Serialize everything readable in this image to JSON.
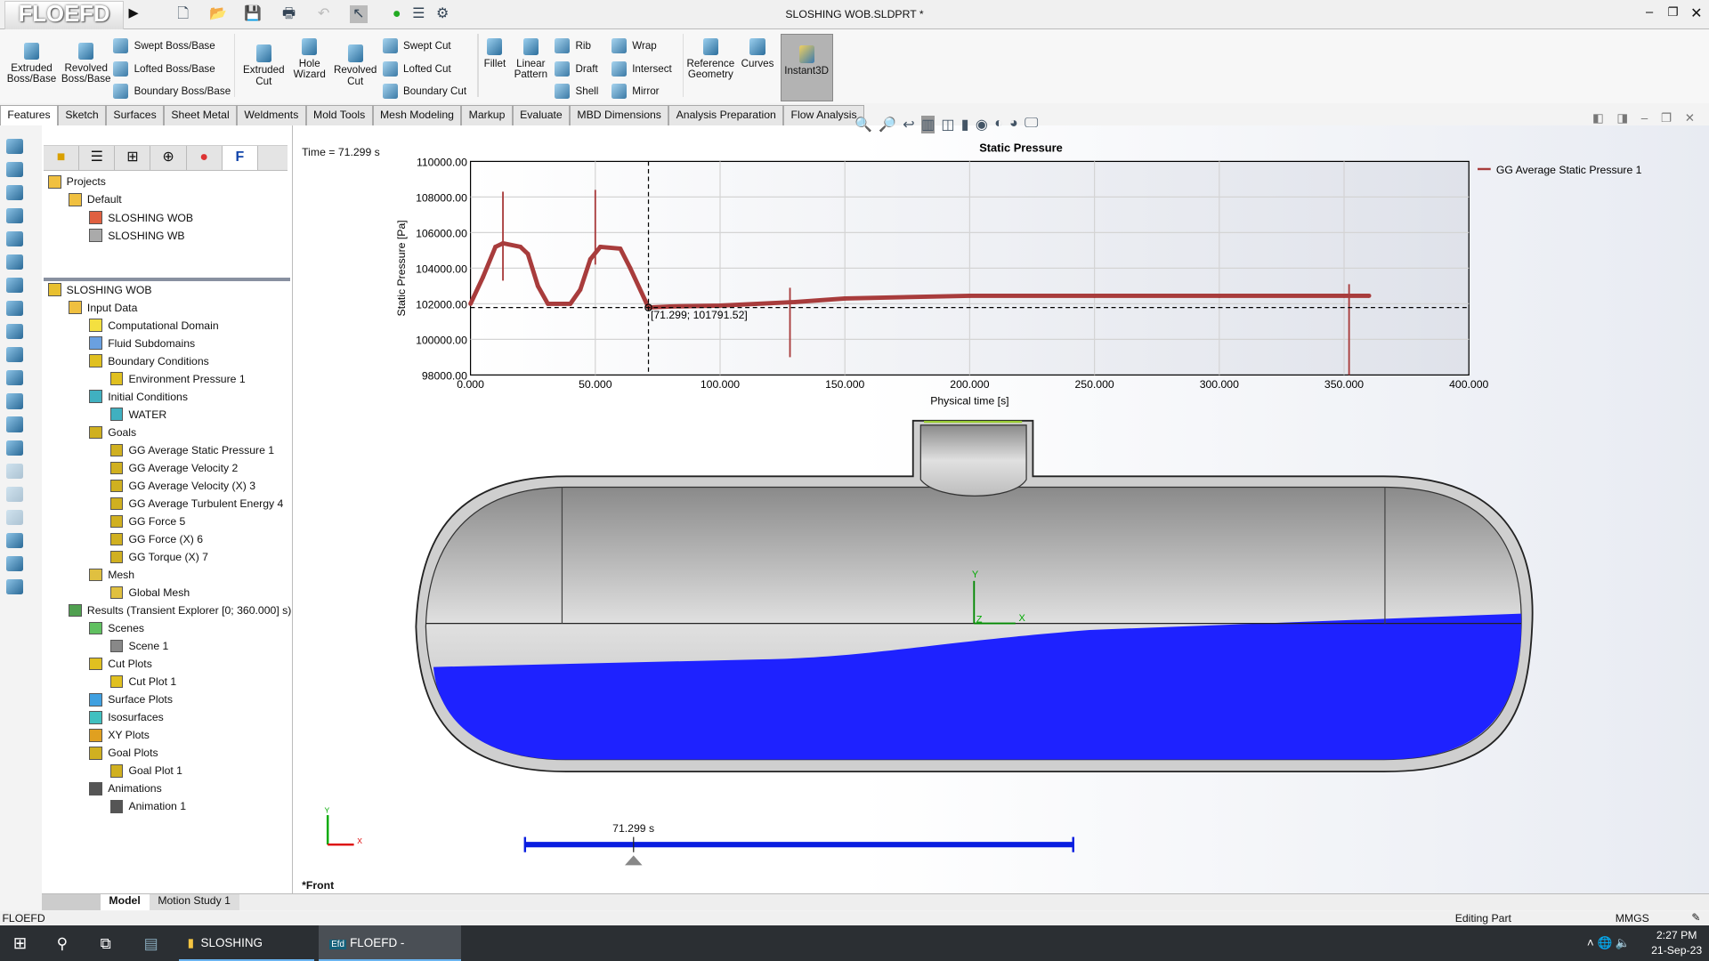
{
  "app": {
    "logo": "FLOEFD",
    "window_title": "SLOSHING WOB.SLDPRT *"
  },
  "quick_access": [
    "new-icon",
    "open-icon",
    "save-icon",
    "print-icon",
    "undo-icon",
    "select-icon",
    "rebuild-icon",
    "file-properties-icon",
    "options-icon"
  ],
  "ribbon": {
    "big": [
      {
        "label": "Extruded Boss/Base"
      },
      {
        "label": "Revolved Boss/Base"
      },
      {
        "label": "Extruded Cut"
      },
      {
        "label": "Hole Wizard"
      },
      {
        "label": "Revolved Cut"
      },
      {
        "label": "Fillet"
      },
      {
        "label": "Linear Pattern"
      },
      {
        "label": "Reference Geometry"
      },
      {
        "label": "Curves"
      },
      {
        "label": "Instant3D"
      }
    ],
    "small": [
      "Swept Boss/Base",
      "Lofted Boss/Base",
      "Boundary Boss/Base",
      "Swept Cut",
      "Lofted Cut",
      "Boundary Cut",
      "Rib",
      "Draft",
      "Shell",
      "Wrap",
      "Intersect",
      "Mirror"
    ]
  },
  "tabs": [
    "Features",
    "Sketch",
    "Surfaces",
    "Sheet Metal",
    "Weldments",
    "Mold Tools",
    "Mesh Modeling",
    "Markup",
    "Evaluate",
    "MBD Dimensions",
    "Analysis Preparation",
    "Flow Analysis"
  ],
  "active_tab": "Features",
  "projects_tree": [
    {
      "label": "Projects",
      "level": 0
    },
    {
      "label": "Default",
      "level": 1
    },
    {
      "label": "SLOSHING WOB",
      "level": 2
    },
    {
      "label": "SLOSHING WB",
      "level": 2
    }
  ],
  "analysis_tree": [
    {
      "label": "SLOSHING WOB",
      "level": 0,
      "color": "#e8c030"
    },
    {
      "label": "Input Data",
      "level": 1,
      "color": "#f0c040"
    },
    {
      "label": "Computational Domain",
      "level": 2,
      "color": "#f4e040"
    },
    {
      "label": "Fluid Subdomains",
      "level": 2,
      "color": "#6aa0e0"
    },
    {
      "label": "Boundary Conditions",
      "level": 2,
      "color": "#e0c020"
    },
    {
      "label": "Environment Pressure 1",
      "level": 3,
      "color": "#e0c020"
    },
    {
      "label": "Initial Conditions",
      "level": 2,
      "color": "#40b0c0"
    },
    {
      "label": "WATER",
      "level": 3,
      "color": "#40b0c0"
    },
    {
      "label": "Goals",
      "level": 2,
      "color": "#d0b020"
    },
    {
      "label": "GG Average Static Pressure 1",
      "level": 3,
      "color": "#d0b020"
    },
    {
      "label": "GG Average Velocity 2",
      "level": 3,
      "color": "#d0b020"
    },
    {
      "label": "GG Average Velocity (X) 3",
      "level": 3,
      "color": "#d0b020"
    },
    {
      "label": "GG Average Turbulent Energy 4",
      "level": 3,
      "color": "#d0b020"
    },
    {
      "label": "GG Force 5",
      "level": 3,
      "color": "#d0b020"
    },
    {
      "label": "GG Force (X) 6",
      "level": 3,
      "color": "#d0b020"
    },
    {
      "label": "GG Torque (X) 7",
      "level": 3,
      "color": "#d0b020"
    },
    {
      "label": "Mesh",
      "level": 2,
      "color": "#e0c040"
    },
    {
      "label": "Global Mesh",
      "level": 3,
      "color": "#e0c040"
    },
    {
      "label": "Results (Transient Explorer [0; 360.000] s)",
      "level": 1,
      "color": "#50a050"
    },
    {
      "label": "Scenes",
      "level": 2,
      "color": "#60c060"
    },
    {
      "label": "Scene 1",
      "level": 3,
      "color": "#888888"
    },
    {
      "label": "Cut Plots",
      "level": 2,
      "color": "#e0c020"
    },
    {
      "label": "Cut Plot 1",
      "level": 3,
      "color": "#e0c020"
    },
    {
      "label": "Surface Plots",
      "level": 2,
      "color": "#40a0e0"
    },
    {
      "label": "Isosurfaces",
      "level": 2,
      "color": "#40c0c0"
    },
    {
      "label": "XY Plots",
      "level": 2,
      "color": "#e0a020"
    },
    {
      "label": "Goal Plots",
      "level": 2,
      "color": "#d0b020"
    },
    {
      "label": "Goal Plot 1",
      "level": 3,
      "color": "#d0b020"
    },
    {
      "label": "Animations",
      "level": 2,
      "color": "#555555"
    },
    {
      "label": "Animation 1",
      "level": 3,
      "color": "#555555"
    }
  ],
  "view": {
    "time_label": "Time = 71.299 s",
    "slider_label": "71.299 s",
    "slider_fraction": 0.198,
    "view_name": "*Front",
    "axis_x": "X",
    "axis_y": "Y",
    "axis_z": "Z"
  },
  "chart_data": {
    "type": "line",
    "title": "Static Pressure",
    "xlabel": "Physical time [s]",
    "ylabel": "Static Pressure [Pa]",
    "xlim": [
      0,
      400
    ],
    "ylim": [
      98000,
      110000
    ],
    "xticks": [
      "0.000",
      "50.000",
      "100.000",
      "150.000",
      "200.000",
      "250.000",
      "300.000",
      "350.000",
      "400.000"
    ],
    "yticks": [
      "98000.00",
      "100000.00",
      "102000.00",
      "104000.00",
      "106000.00",
      "108000.00",
      "110000.00"
    ],
    "grid": true,
    "legend_position": "right",
    "series": [
      {
        "name": "GG Average Static Pressure 1",
        "color": "#a83c3c",
        "x": [
          0,
          5,
          10,
          13,
          20,
          23,
          27,
          31,
          40,
          44,
          48,
          52,
          60,
          64,
          71.299,
          80,
          100,
          130,
          150,
          200,
          250,
          300,
          350,
          360
        ],
        "y": [
          102000,
          103500,
          105200,
          105400,
          105200,
          104800,
          103000,
          102000,
          102000,
          102800,
          104500,
          105200,
          105100,
          104000,
          101791.52,
          101850,
          101900,
          102100,
          102300,
          102450,
          102450,
          102450,
          102450,
          102450
        ]
      }
    ],
    "spikes": [
      {
        "x": 13,
        "low": 103300,
        "high": 108300
      },
      {
        "x": 50,
        "low": 104200,
        "high": 108400
      },
      {
        "x": 128,
        "low": 99000,
        "high": 102900
      },
      {
        "x": 352,
        "low": 98000,
        "high": 103100
      }
    ],
    "cursor": {
      "x": 71.299,
      "y": 101791.52,
      "label": "[71.299; 101791.52]"
    }
  },
  "bottom_tabs": [
    "Model",
    "Motion Study 1"
  ],
  "status": {
    "left": "FLOEFD",
    "mode": "Editing Part",
    "units": "MMGS"
  },
  "taskbar": {
    "apps": [
      "SLOSHING",
      "FLOEFD - [SLOSHI..."
    ],
    "time": "2:27 PM",
    "date": "21-Sep-23"
  }
}
